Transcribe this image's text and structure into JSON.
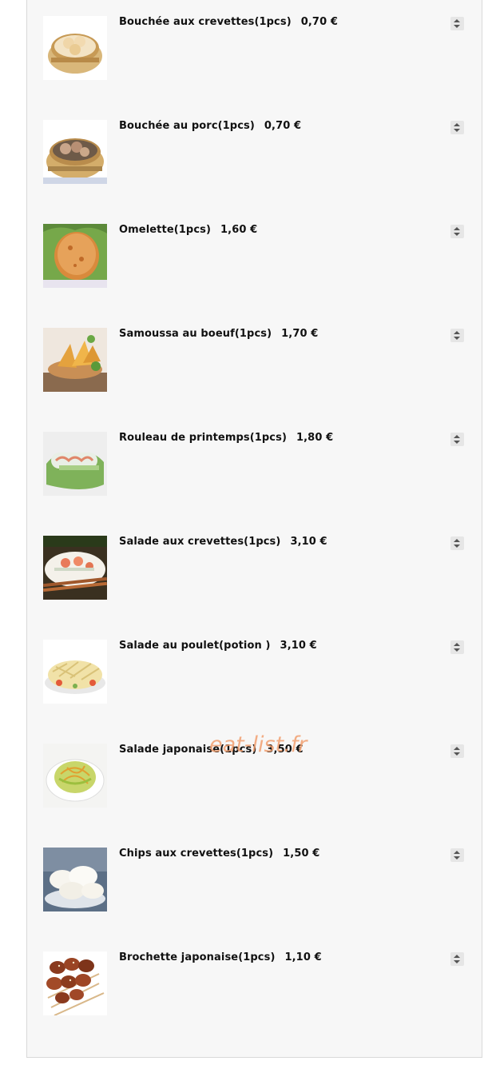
{
  "menu": {
    "items": [
      {
        "name": "Bouchée aux crevettes(1pcs)",
        "price": "0,70 €",
        "image": "shrimp-dumpling-photo"
      },
      {
        "name": "Bouchée au porc(1pcs)",
        "price": "0,70 €",
        "image": "pork-dumpling-photo"
      },
      {
        "name": "Omelette(1pcs)",
        "price": "1,60 €",
        "image": "omelette-photo"
      },
      {
        "name": "Samoussa au boeuf(1pcs)",
        "price": "1,70 €",
        "image": "samosa-photo"
      },
      {
        "name": "Rouleau de printemps(1pcs)",
        "price": "1,80 €",
        "image": "spring-roll-photo"
      },
      {
        "name": "Salade aux crevettes(1pcs)",
        "price": "3,10 €",
        "image": "shrimp-salad-photo"
      },
      {
        "name": "Salade au poulet(potion )",
        "price": "3,10 €",
        "image": "chicken-salad-photo"
      },
      {
        "name": "Salade japonaise(1pcs)",
        "price": "3,50 €",
        "image": "japanese-salad-photo"
      },
      {
        "name": "Chips aux crevettes(1pcs)",
        "price": "1,50 €",
        "image": "prawn-crackers-photo"
      },
      {
        "name": "Brochette japonaise(1pcs)",
        "price": "1,10 €",
        "image": "yakitori-photo"
      }
    ]
  },
  "watermark": "eat-list.fr",
  "colors": {
    "panel_bg": "#f7f7f7",
    "watermark": "#f2a070",
    "stepper_bg": "#e6e6e6"
  }
}
